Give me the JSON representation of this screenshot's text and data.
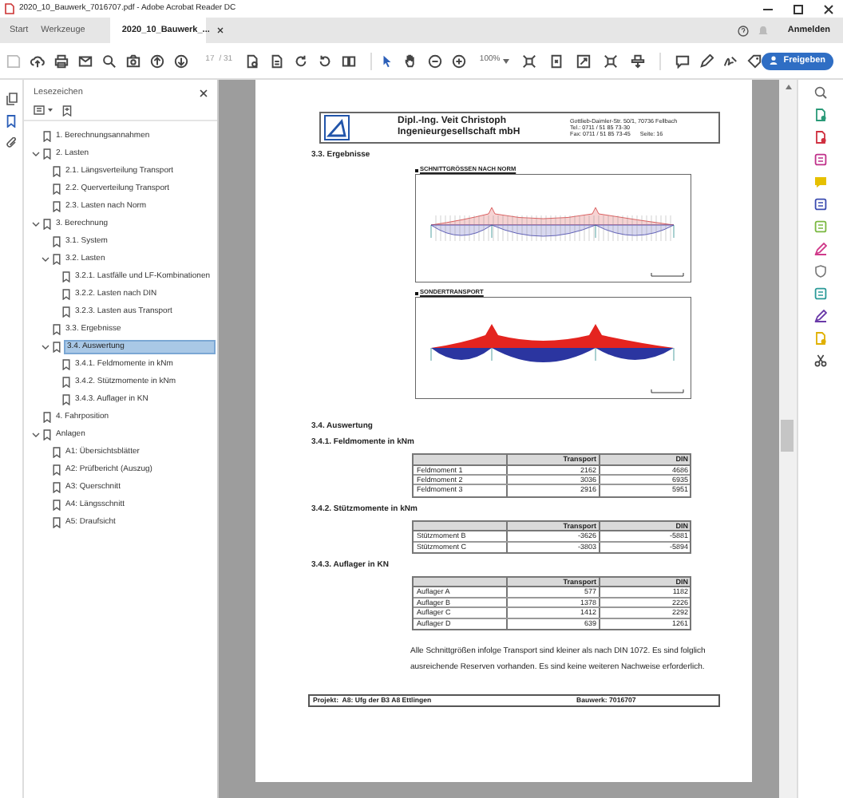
{
  "window": {
    "title": "2020_10_Bauwerk_7016707.pdf - Adobe Acrobat Reader DC"
  },
  "tabs": [
    {
      "label": "Start",
      "selected": false
    },
    {
      "label": "Werkzeuge",
      "selected": false
    },
    {
      "label": "2020_10_Bauwerk_...",
      "selected": true
    }
  ],
  "account": {
    "sign_in": "Anmelden"
  },
  "toolbar": {
    "page": "17",
    "page_count": "/ 31",
    "zoom": "100%",
    "share": "Freigeben"
  },
  "bookmarks": {
    "title": "Lesezeichen",
    "items": [
      {
        "label": "1. Berechnungsannahmen",
        "selected": false
      },
      {
        "label": "2. Lasten",
        "selected": false,
        "expanded": true,
        "children": [
          {
            "label": "2.1. Längsverteilung Transport",
            "selected": false
          },
          {
            "label": "2.2. Querverteilung Transport",
            "selected": false
          },
          {
            "label": "2.3. Lasten nach Norm",
            "selected": false
          }
        ]
      },
      {
        "label": "3. Berechnung",
        "selected": false,
        "expanded": true,
        "children": [
          {
            "label": "3.1. System",
            "selected": false
          },
          {
            "label": "3.2. Lasten",
            "selected": false,
            "expanded": true,
            "children": [
              {
                "label": "3.2.1. Lastfälle und LF-Kombinationen",
                "selected": false
              },
              {
                "label": "3.2.2. Lasten nach DIN",
                "selected": false
              },
              {
                "label": "3.2.3. Lasten aus Transport",
                "selected": false
              }
            ]
          },
          {
            "label": "3.3. Ergebnisse",
            "selected": false
          },
          {
            "label": "3.4. Auswertung",
            "selected": true,
            "expanded": true,
            "children": [
              {
                "label": "3.4.1. Feldmomente in kNm",
                "selected": false
              },
              {
                "label": "3.4.2. Stützmomente in kNm",
                "selected": false
              },
              {
                "label": "3.4.3. Auflager in KN",
                "selected": false
              }
            ]
          }
        ]
      },
      {
        "label": "4. Fahrposition",
        "selected": false
      },
      {
        "label": "Anlagen",
        "selected": false,
        "expanded": true,
        "children": [
          {
            "label": "A1: Übersichtsblätter",
            "selected": false
          },
          {
            "label": "A2: Prüfbericht (Auszug)",
            "selected": false
          },
          {
            "label": "A3: Querschnitt",
            "selected": false
          },
          {
            "label": "A4: Längsschnitt",
            "selected": false
          },
          {
            "label": "A5: Draufsicht",
            "selected": false
          }
        ]
      }
    ]
  },
  "document": {
    "letterhead": {
      "name_lines": [
        "Dipl.-Ing. Veit Christoph",
        "Ingenieurgesellschaft mbH"
      ],
      "address": "Gottlieb-Daimler-Str. 50/1, 70736 Fellbach",
      "phone": "Tel.: 0711 / 51 85 73-30",
      "fax": "Fax: 0711 / 51 85 73-45",
      "page": "Seite: 16"
    },
    "sections": [
      {
        "kind": "heading",
        "text": "3.3. Ergebnisse"
      },
      {
        "kind": "hatched_diagram",
        "title": "SCHNITTGRÖSSEN NACH NORM"
      },
      {
        "kind": "filled_diagram",
        "title": "SONDERTRANSPORT"
      },
      {
        "kind": "heading",
        "text": "3.4. Auswertung"
      },
      {
        "kind": "heading",
        "text": "3.4.1. Feldmomente in kNm"
      },
      {
        "kind": "table",
        "columns": [
          "Transport",
          "DIN"
        ],
        "rows": [
          {
            "label": "Feldmoment 1",
            "values": [
              "2162",
              "4686"
            ]
          },
          {
            "label": "Feldmoment 2",
            "values": [
              "3036",
              "6935"
            ]
          },
          {
            "label": "Feldmoment 3",
            "values": [
              "2916",
              "5951"
            ]
          }
        ]
      },
      {
        "kind": "heading",
        "text": "3.4.2. Stützmomente in kNm"
      },
      {
        "kind": "table",
        "columns": [
          "Transport",
          "DIN"
        ],
        "rows": [
          {
            "label": "Stützmoment B",
            "values": [
              "-3626",
              "-5881"
            ]
          },
          {
            "label": "Stützmoment C",
            "values": [
              "-3803",
              "-5894"
            ]
          }
        ]
      },
      {
        "kind": "heading",
        "text": "3.4.3. Auflager in KN"
      },
      {
        "kind": "table",
        "columns": [
          "Transport",
          "DIN"
        ],
        "rows": [
          {
            "label": "Auflager A",
            "values": [
              "577",
              "1182"
            ]
          },
          {
            "label": "Auflager B",
            "values": [
              "1378",
              "2226"
            ]
          },
          {
            "label": "Auflager C",
            "values": [
              "1412",
              "2292"
            ]
          },
          {
            "label": "Auflager D",
            "values": [
              "639",
              "1261"
            ]
          }
        ]
      },
      {
        "kind": "paragraph",
        "text": "Alle Schnittgrößen infolge Transport sind kleiner als nach DIN 1072. Es sind folglich ausreichende Reserven vorhanden. Es sind keine weiteren Nachweise erforderlich."
      }
    ],
    "footer": {
      "project": "Projekt:  A8: Ufg der B3 A8 Ettlingen",
      "structure": "Bauwerk: 7016707"
    }
  }
}
